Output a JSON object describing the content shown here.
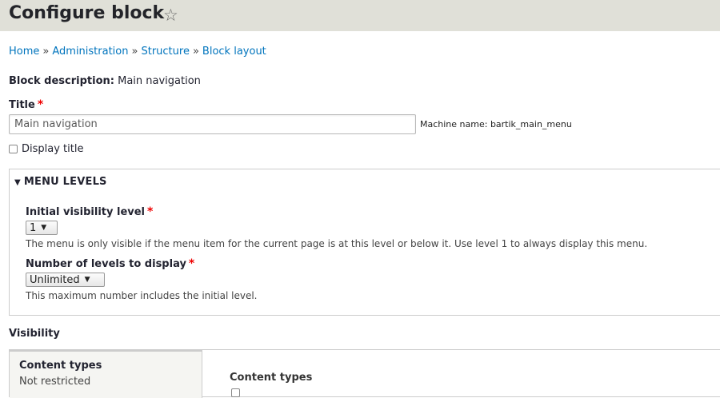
{
  "header": {
    "title": "Configure block",
    "star_icon": "☆"
  },
  "breadcrumb": {
    "items": [
      "Home",
      "Administration",
      "Structure",
      "Block layout"
    ],
    "separator": "»"
  },
  "block_description": {
    "label": "Block description:",
    "value": "Main navigation"
  },
  "title_field": {
    "label": "Title",
    "required": "*",
    "value": "Main navigation",
    "machine_name": "Machine name: bartik_main_menu"
  },
  "display_title": {
    "label": "Display title",
    "checked": false
  },
  "menu_levels": {
    "summary": "MENU LEVELS",
    "toggle_icon": "▼",
    "initial_level": {
      "label": "Initial visibility level",
      "required": "*",
      "selected": "1",
      "description": "The menu is only visible if the menu item for the current page is at this level or below it. Use level 1 to always display this menu."
    },
    "depth": {
      "label": "Number of levels to display",
      "required": "*",
      "selected": "Unlimited",
      "description": "This maximum number includes the initial level."
    },
    "caret_icon": "▼"
  },
  "visibility": {
    "label": "Visibility",
    "tab": {
      "title": "Content types",
      "summary": "Not restricted"
    },
    "pane_title": "Content types"
  },
  "colors": {
    "link": "#0074bd",
    "header_bg": "#e0e0d8",
    "required": "#ee0000"
  }
}
